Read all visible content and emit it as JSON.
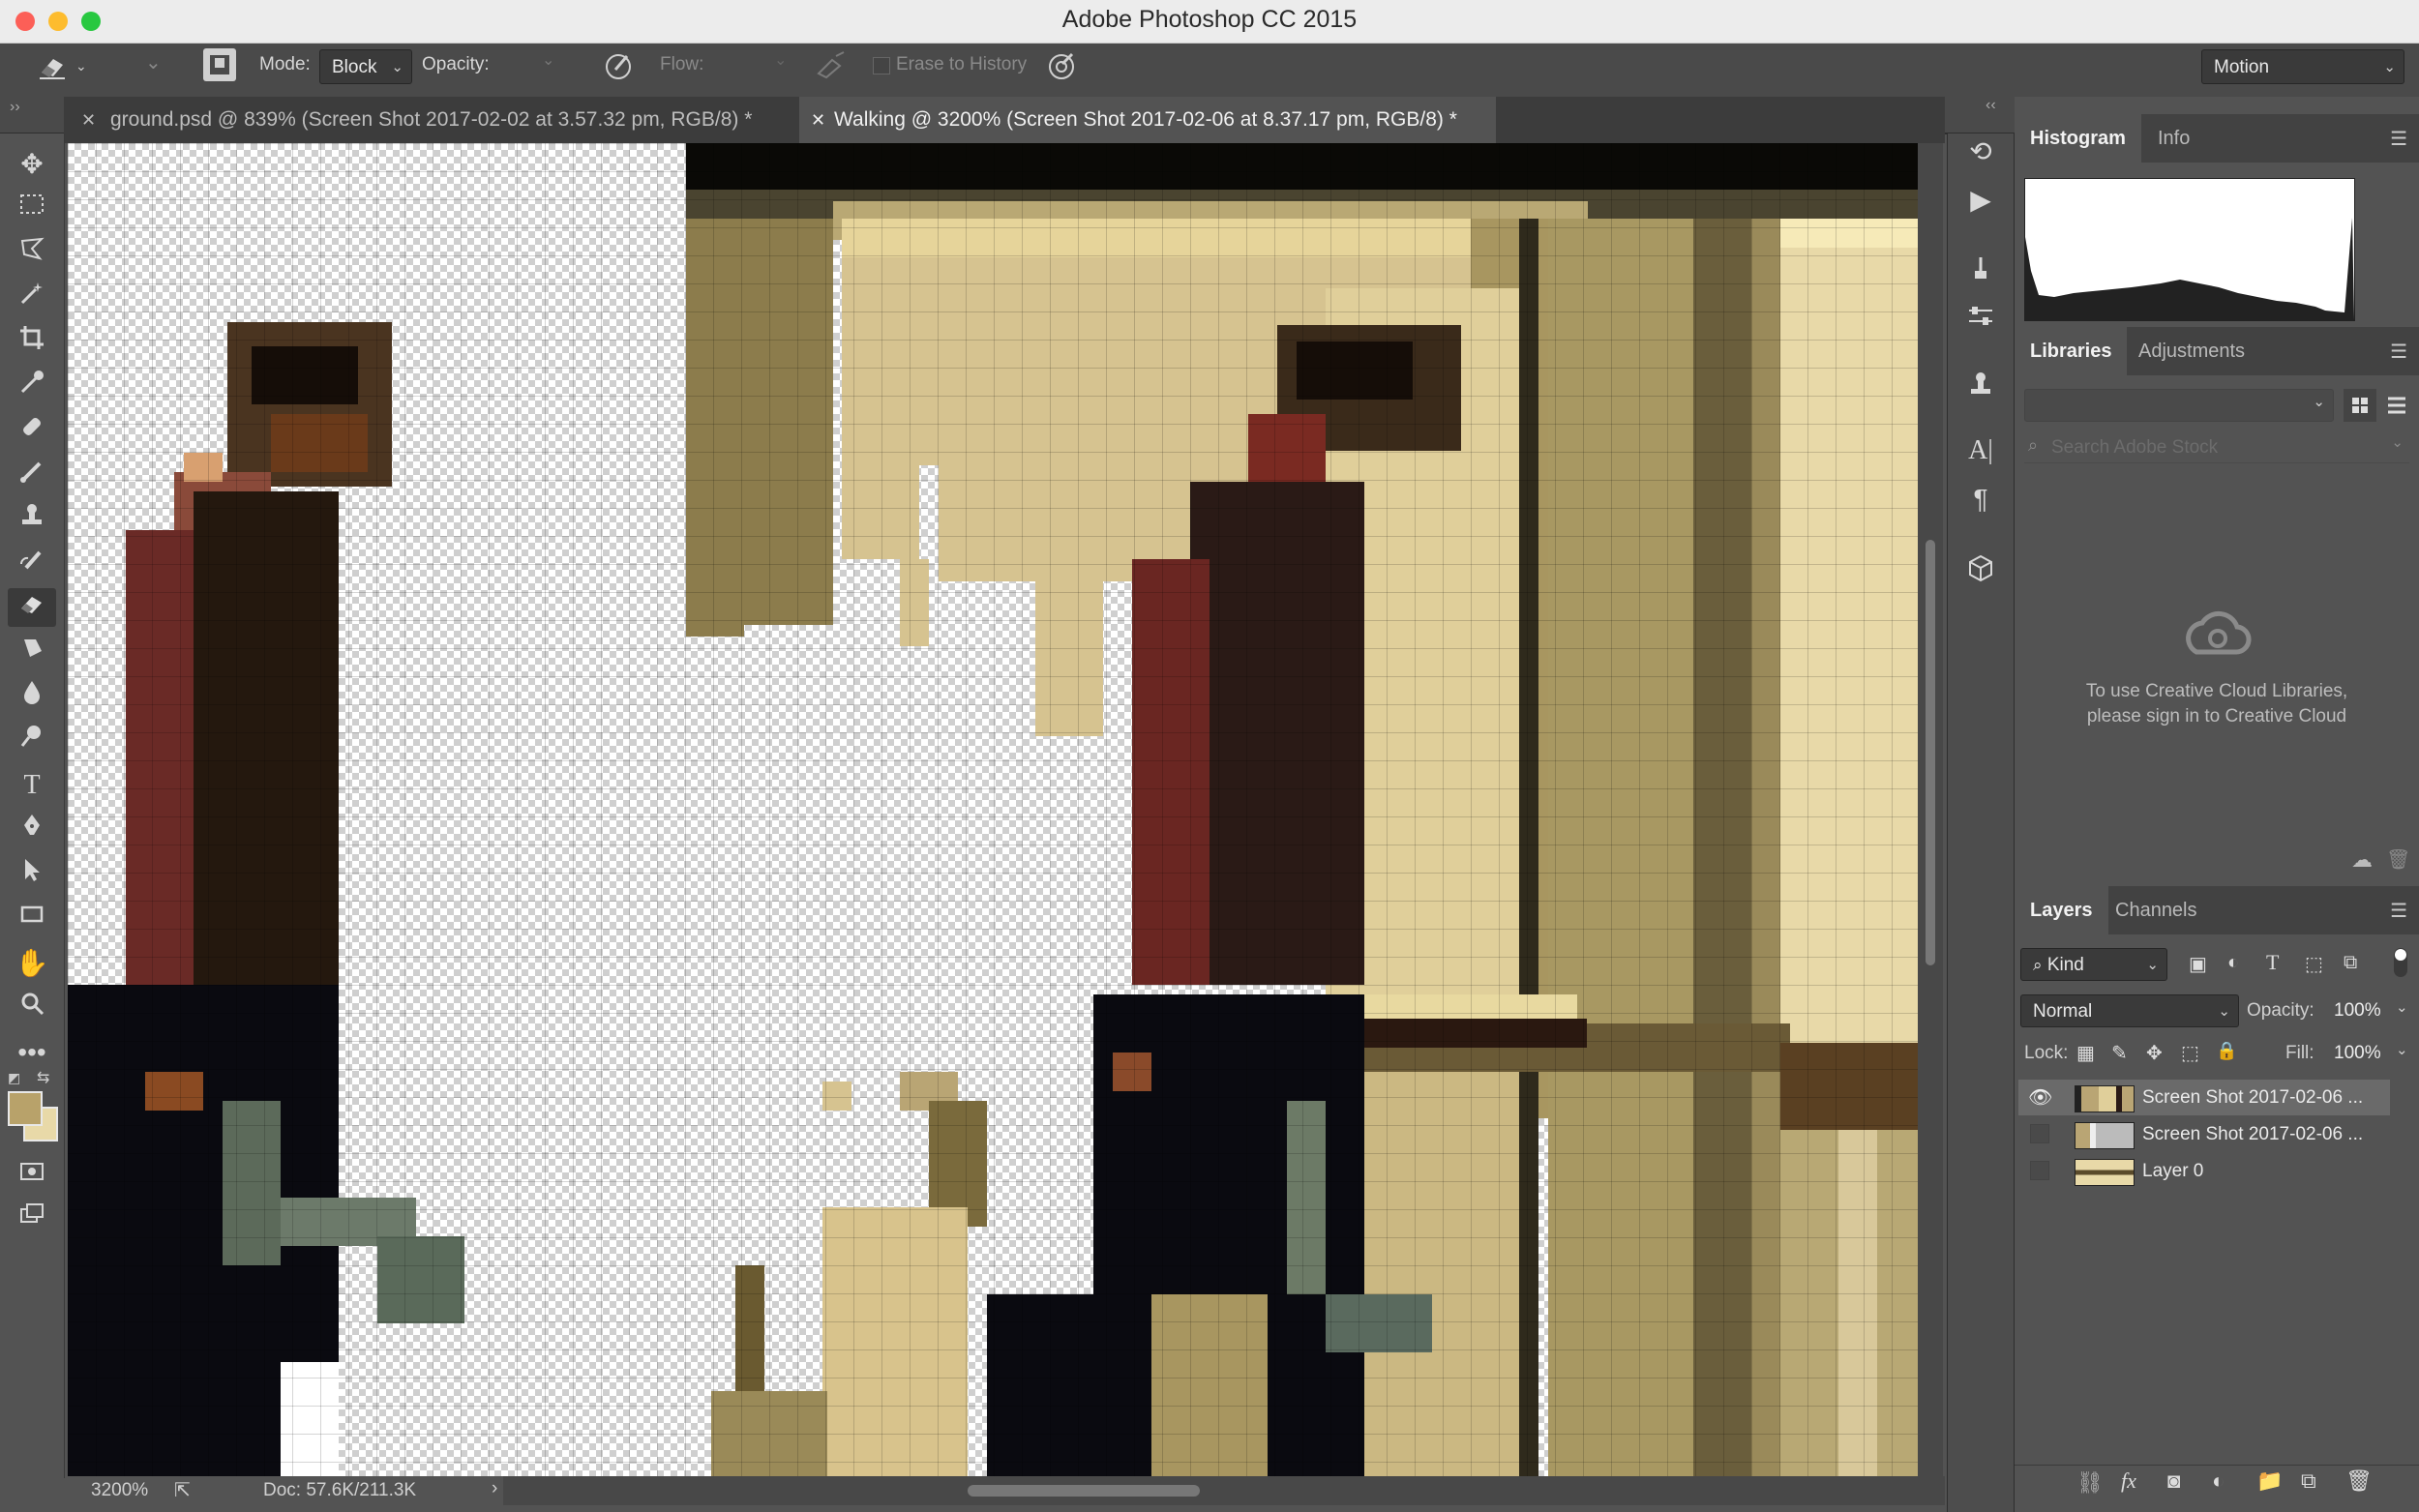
{
  "window": {
    "title": "Adobe Photoshop CC 2015"
  },
  "options_bar": {
    "mode_label": "Mode:",
    "mode_value": "Block",
    "opacity_label": "Opacity:",
    "flow_label": "Flow:",
    "erase_history_label": "Erase to History",
    "workspace_value": "Motion"
  },
  "tabs": [
    {
      "label": "ground.psd @ 839% (Screen Shot 2017-02-02 at 3.57.32 pm, RGB/8) *",
      "active": false
    },
    {
      "label": "Walking @ 3200% (Screen Shot 2017-02-06 at 8.37.17 pm, RGB/8) *",
      "active": true
    }
  ],
  "status": {
    "zoom": "3200%",
    "doc": "Doc: 57.6K/211.3K"
  },
  "panels": {
    "histogram_tab": "Histogram",
    "info_tab": "Info",
    "libraries_tab": "Libraries",
    "adjustments_tab": "Adjustments",
    "search_placeholder": "Search Adobe Stock",
    "libraries_message": "To use Creative Cloud Libraries, please sign in to Creative Cloud",
    "layers_tab": "Layers",
    "channels_tab": "Channels",
    "kind_filter": "Kind",
    "blend_mode": "Normal",
    "opacity_label": "Opacity:",
    "opacity_value": "100%",
    "lock_label": "Lock:",
    "fill_label": "Fill:",
    "fill_value": "100%",
    "layers": [
      {
        "name": "Screen Shot 2017-02-06 ...",
        "visible": true,
        "selected": true
      },
      {
        "name": "Screen Shot 2017-02-06 ...",
        "visible": false,
        "selected": false
      },
      {
        "name": "Layer 0",
        "visible": false,
        "selected": false
      }
    ]
  },
  "colors": {
    "foreground": "#b8a26a",
    "background": "#e8d9a8",
    "accent": "#6a8fd8"
  },
  "icons": [
    "eraser-icon",
    "move-icon",
    "marquee-icon",
    "lasso-icon",
    "magic-wand-icon",
    "crop-icon",
    "eyedropper-icon",
    "healing-icon",
    "brush-icon",
    "stamp-icon",
    "history-brush-icon",
    "gradient-icon",
    "blur-icon",
    "dodge-icon",
    "type-icon",
    "pen-icon",
    "path-select-icon",
    "rectangle-icon",
    "hand-icon",
    "zoom-icon",
    "more-icon"
  ]
}
